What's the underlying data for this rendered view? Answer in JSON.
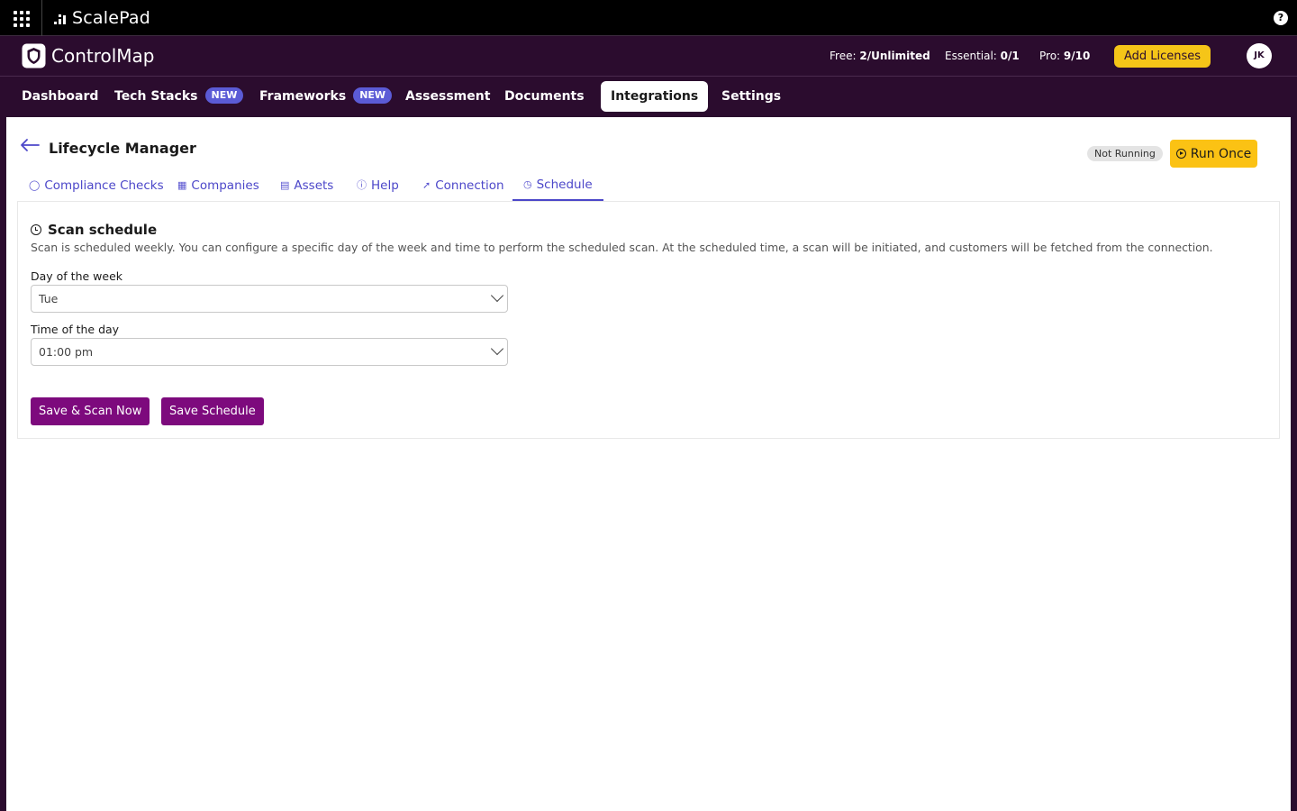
{
  "scalepad": {
    "brand": "ScalePad",
    "help_icon": "?"
  },
  "controlmap": {
    "brand": "ControlMap"
  },
  "licenses": {
    "free_label": "Free:",
    "free_value": "2/Unlimited",
    "essential_label": "Essential:",
    "essential_value": "0/1",
    "pro_label": "Pro:",
    "pro_value": "9/10",
    "add_button": "Add Licenses"
  },
  "user": {
    "initials": "JK"
  },
  "nav": {
    "dashboard": "Dashboard",
    "tech_stacks": "Tech Stacks",
    "tech_stacks_badge": "NEW",
    "frameworks": "Frameworks",
    "frameworks_badge": "NEW",
    "assessment": "Assessment",
    "documents": "Documents",
    "integrations": "Integrations",
    "settings": "Settings"
  },
  "page": {
    "title": "Lifecycle Manager",
    "status": "Not Running",
    "run_button": "Run Once"
  },
  "tabs": {
    "compliance": "Compliance Checks",
    "companies": "Companies",
    "assets": "Assets",
    "help": "Help",
    "connection": "Connection",
    "schedule": "Schedule"
  },
  "schedule": {
    "title": "Scan schedule",
    "description": "Scan is scheduled weekly. You can configure a specific day of the week and time to perform the scheduled scan. At the scheduled time, a scan will be initiated, and customers will be fetched from the connection.",
    "day_label": "Day of the week",
    "day_value": "Tue",
    "time_label": "Time of the day",
    "time_value": "01:00 pm",
    "save_scan_button": "Save & Scan Now",
    "save_button": "Save Schedule"
  },
  "colors": {
    "brand_dark": "#2b0c2e",
    "accent_yellow": "#fbc214",
    "tab_blue": "#4c47c9",
    "badge_blue": "#5b5bd6",
    "button_purple": "#7d0a7d"
  }
}
